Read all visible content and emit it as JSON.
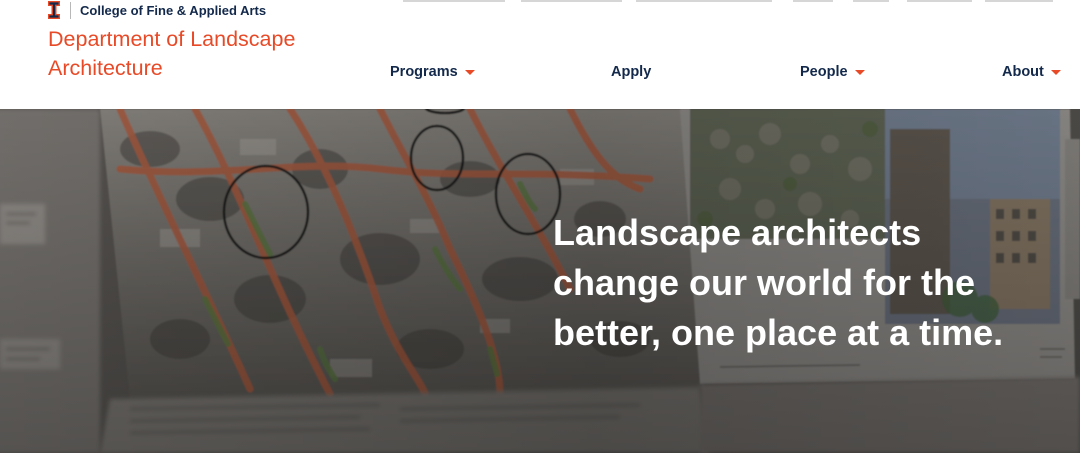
{
  "header": {
    "college_name": "College of Fine & Applied Arts",
    "department_name": "Department of Landscape Architecture",
    "logo_icon": "block-i-icon",
    "brand_colors": {
      "orange": "#e84a27",
      "blue": "#13294b"
    }
  },
  "nav": {
    "items": [
      {
        "label": "Programs",
        "has_dropdown": true
      },
      {
        "label": "Apply",
        "has_dropdown": false
      },
      {
        "label": "People",
        "has_dropdown": true
      },
      {
        "label": "About",
        "has_dropdown": true
      }
    ],
    "dropdown_icon": "caret-down-icon"
  },
  "hero": {
    "headline": "Landscape architects change our world for the better, one place at a time.",
    "background": "photo of landscape architecture site plans pinned to a wall"
  }
}
